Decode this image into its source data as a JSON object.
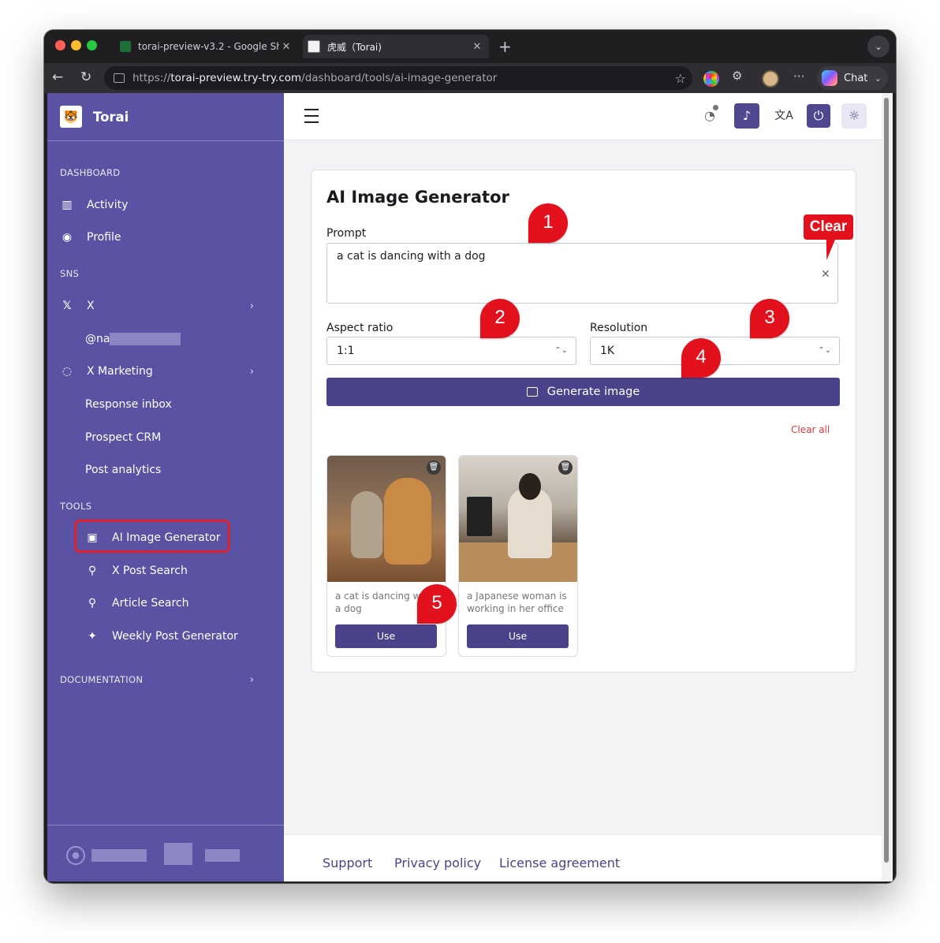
{
  "browser": {
    "tabs": [
      {
        "title": "torai-preview-v3.2 - Google She",
        "active": false
      },
      {
        "title": "虎威（Torai)",
        "active": true
      }
    ],
    "url_scheme": "https://",
    "url_host": "torai-preview.try-try.com",
    "url_path": "/dashboard/tools/ai-image-generator",
    "chat_label": "Chat"
  },
  "sidebar": {
    "brand": "Torai",
    "sections": {
      "dashboard": "DASHBOARD",
      "sns": "SNS",
      "tools": "TOOLS",
      "documentation": "DOCUMENTATION"
    },
    "items": {
      "activity": "Activity",
      "profile": "Profile",
      "x": "X",
      "x_account": "@na",
      "x_marketing": "X Marketing",
      "response_inbox": "Response inbox",
      "prospect_crm": "Prospect CRM",
      "post_analytics": "Post analytics",
      "ai_image_generator": "AI Image Generator",
      "x_post_search": "X Post Search",
      "article_search": "Article Search",
      "weekly_post_generator": "Weekly Post Generator"
    }
  },
  "main": {
    "title": "AI Image Generator",
    "prompt_label": "Prompt",
    "prompt_value": "a cat is dancing with a dog",
    "aspect_label": "Aspect ratio",
    "aspect_value": "1:1",
    "resolution_label": "Resolution",
    "resolution_value": "1K",
    "generate_label": "Generate image",
    "clear_all_label": "Clear all",
    "images": [
      {
        "caption": "a cat is dancing with a dog",
        "use_label": "Use"
      },
      {
        "caption": "a Japanese woman is working in her office",
        "use_label": "Use"
      }
    ]
  },
  "footer": {
    "support": "Support",
    "privacy": "Privacy policy",
    "license": "License agreement"
  },
  "annotations": {
    "markers": [
      "1",
      "2",
      "3",
      "4",
      "5"
    ],
    "clear_callout": "Clear"
  },
  "colors": {
    "sidebar_bg": "#5a52a2",
    "primary": "#4a428a",
    "annotation_red": "#e3101d",
    "danger_link": "#d23a3a"
  }
}
